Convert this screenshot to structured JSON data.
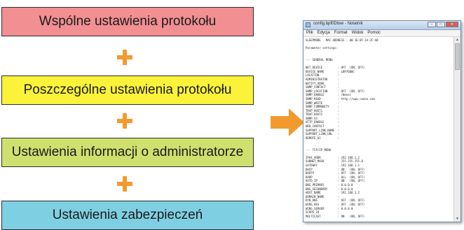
{
  "boxes": {
    "common": "Wspólne ustawienia protokołu",
    "individual": "Poszczególne ustawienia protokołu",
    "admin": "Ustawienia informacji o administratorze",
    "security": "Ustawienia zabezpieczeń"
  },
  "colors": {
    "common": "#f18f92",
    "individual": "#fbf23a",
    "admin": "#cfe06f",
    "security": "#7fcfe3",
    "plus": "#f29a2e",
    "arrow": "#f29a2e"
  },
  "notepad": {
    "title": "config.bpf0Dbxe - Notatnik",
    "menu": [
      "Plik",
      "Edycja",
      "Format",
      "Widok",
      "Pomoc"
    ],
    "lines": [
      "SLEEPMODE   MAC ADDRESS : 00:1E:8F:1A:2F:A0",
      "",
      "Parameter settings:",
      "",
      "",
      "--- GENERAL MENU",
      "",
      "NET_DEVICE         : OFF  (ON, OFF)",
      "DEVICE_NAME        : LBP7680C",
      "LOCATION           :",
      "ADMINISTRATOR      :",
      "NOTIFY_ADDR        :",
      "SNMP_CONTACT       :",
      "SNMP_LOCATION      : OFF  (ON, OFF)",
      "SNMP_ENABLE        : (None)",
      "SNMP_READ          : http://www.canon.com",
      "SNMP_WRITE         :",
      "SNMP_COMMUNITY     :",
      "TRAP_HOST1         :",
      "TRAP_HOST2         :",
      "SNMP_V3            :",
      "HTTP_ENABLE        :",
      "WEB_CONTACT        :",
      "SUPPORT_LINK_NAME  :",
      "SUPPORT_LINK_URL   :",
      "REMOTE_UI          :",
      "",
      "",
      "--- TCP/IP MENU",
      "",
      "IPV4_ADDR          : 192.168.1.2",
      "SUBNET_MASK        : 255.255.255.0",
      "GATEWAY            : 192.168.1.1",
      "DHCP               : ON   (ON, OFF)",
      "BOOTP              : OFF  (ON, OFF)",
      "RARP               : ALL  (ON, OFF)",
      "AUTO_IP            : ON   (ON, OFF)",
      "DNS_PRIMARY        : 0.0.0.0",
      "DNS_SECONDARY      : 0.0.0.0",
      "HOST_NAME          : 192.168.1.2",
      "DOMAIN_NAME        :",
      "DYN_DNS            : OFF  (ON, OFF)",
      "WINS_RES           : OFF  (ON, OFF)",
      "WINS_SERVER        : 0.0.0.0",
      "SCOPE_ID           :",
      "MULTICAST          : ON   (ON, OFF)"
    ]
  }
}
